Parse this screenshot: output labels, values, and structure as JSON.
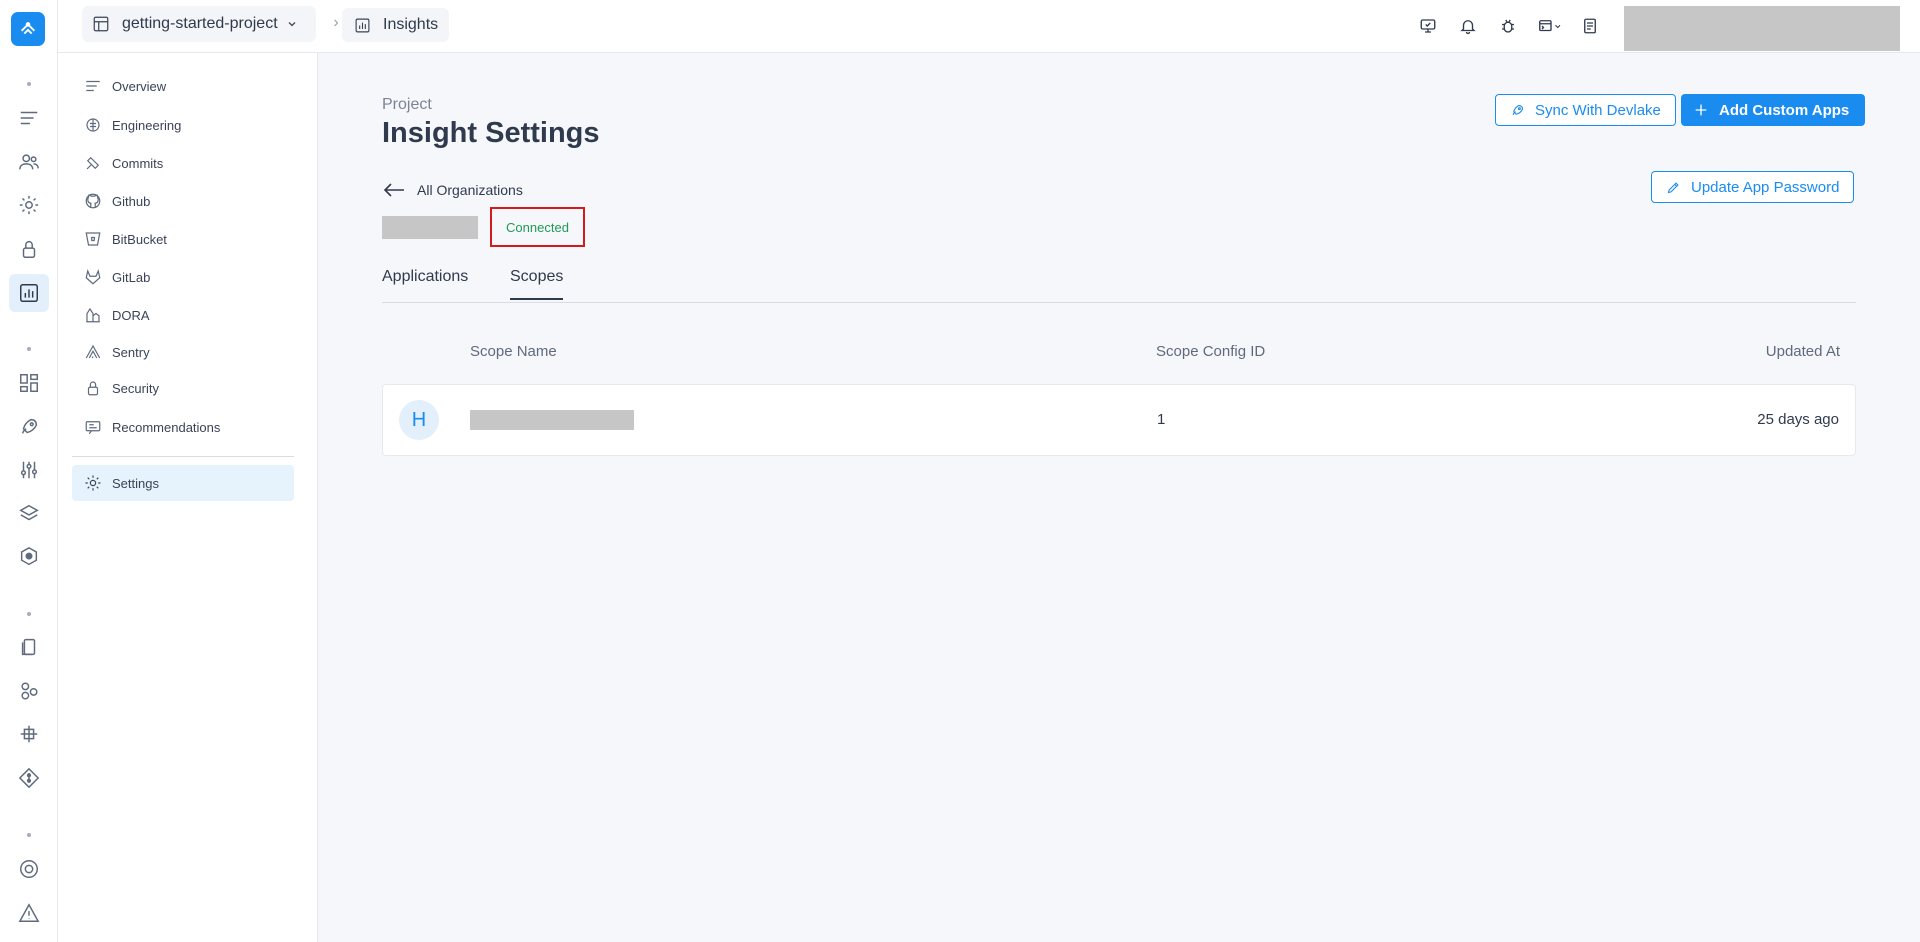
{
  "breadcrumb": {
    "project": "getting-started-project",
    "separator": "›",
    "section": "Insights"
  },
  "subnav": {
    "items": [
      {
        "label": "Overview",
        "icon": "lines-icon"
      },
      {
        "label": "Engineering",
        "icon": "brain-icon"
      },
      {
        "label": "Commits",
        "icon": "commit-icon"
      },
      {
        "label": "Github",
        "icon": "github-icon"
      },
      {
        "label": "BitBucket",
        "icon": "bitbucket-icon"
      },
      {
        "label": "GitLab",
        "icon": "gitlab-icon"
      },
      {
        "label": "DORA",
        "icon": "dora-icon"
      },
      {
        "label": "Sentry",
        "icon": "sentry-icon"
      },
      {
        "label": "Security",
        "icon": "lock-icon"
      },
      {
        "label": "Recommendations",
        "icon": "recommendation-icon"
      },
      {
        "label": "Settings",
        "icon": "gear-icon",
        "active": true
      }
    ]
  },
  "main": {
    "eyebrow": "Project",
    "title": "Insight Settings",
    "sync_button": "Sync With Devlake",
    "add_button": "Add Custom Apps",
    "update_password_button": "Update App Password",
    "back_link": "All Organizations",
    "status": "Connected",
    "tabs": [
      {
        "label": "Applications",
        "active": false
      },
      {
        "label": "Scopes",
        "active": true
      }
    ],
    "table": {
      "headers": [
        "Scope Name",
        "Scope Config ID",
        "Updated At"
      ],
      "rows": [
        {
          "avatar": "H",
          "scope_config_id": "1",
          "updated_at": "25 days ago"
        }
      ]
    }
  },
  "colors": {
    "accent": "#1a8cf0",
    "success": "#1f9a56",
    "highlight": "#d41a1a"
  }
}
